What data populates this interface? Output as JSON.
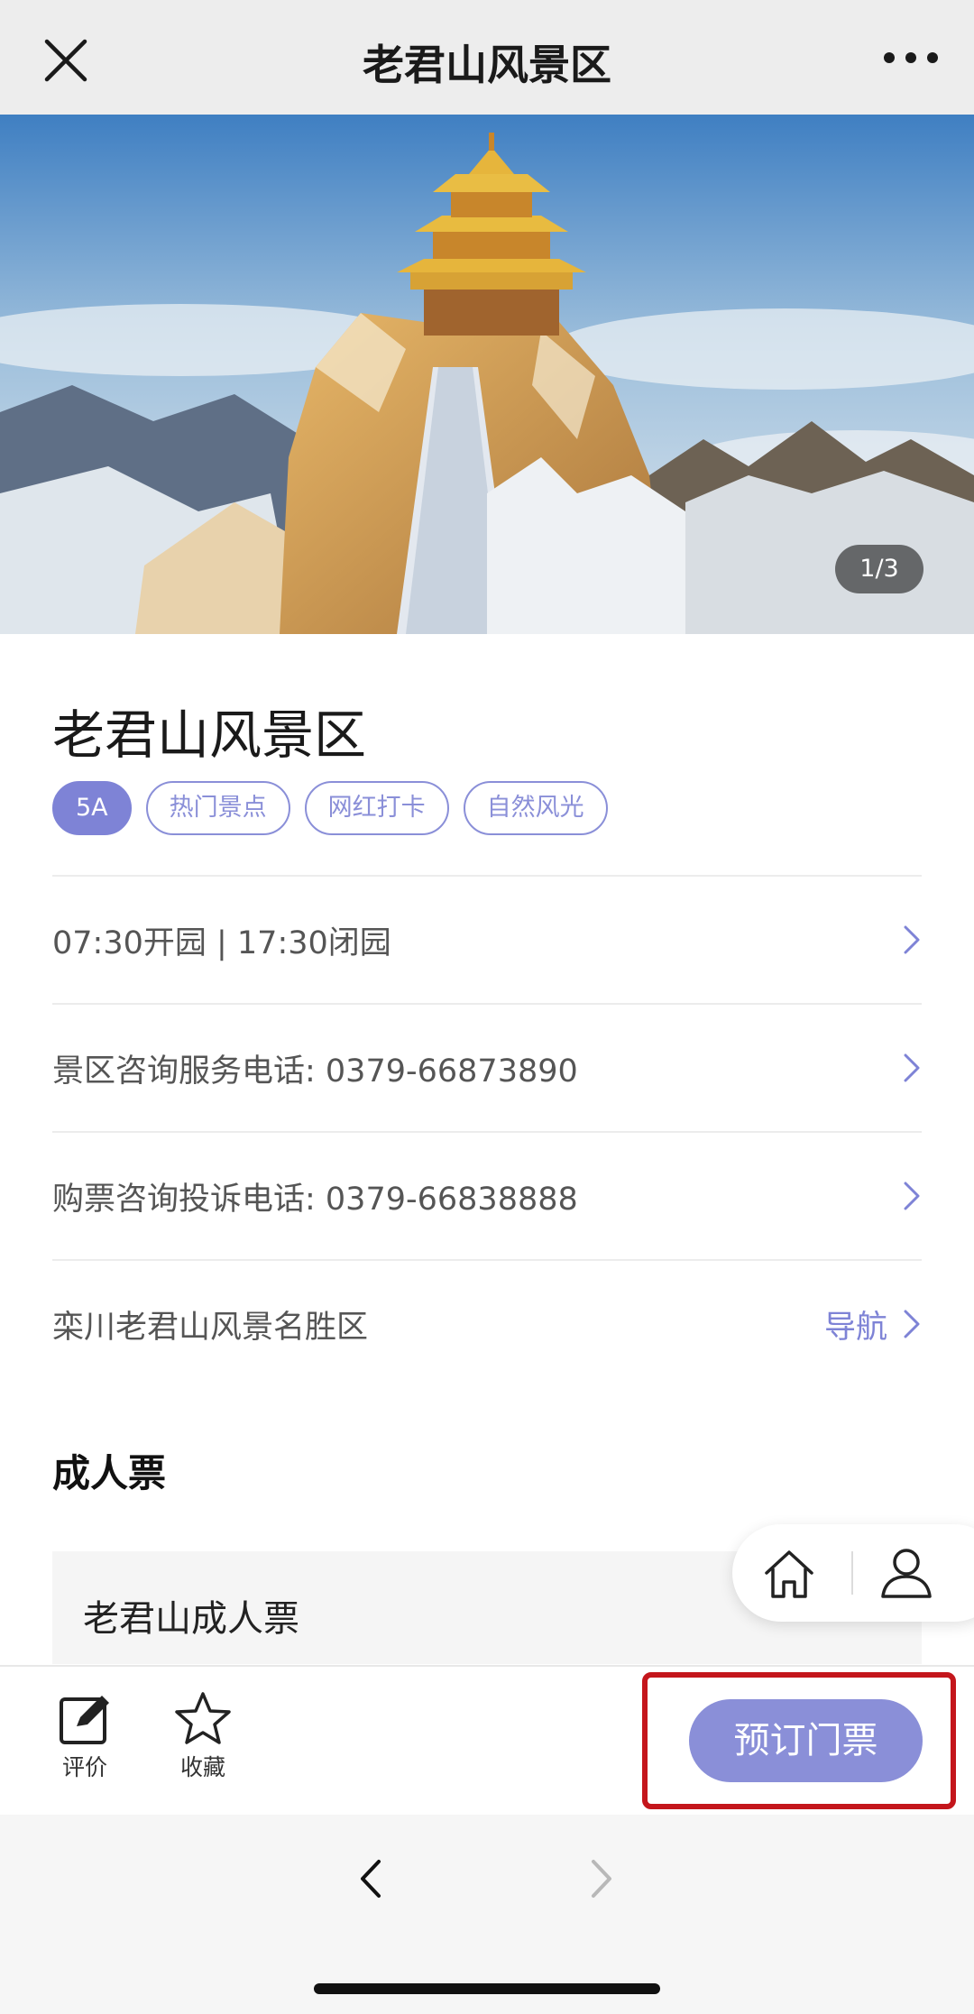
{
  "header": {
    "title": "老君山风景区",
    "close_icon": "close-icon",
    "more_icon": "more-dots-icon"
  },
  "hero": {
    "page_indicator": "1/3"
  },
  "scenic": {
    "title": "老君山风景区",
    "tags": [
      "5A",
      "热门景点",
      "网红打卡",
      "自然风光"
    ]
  },
  "info": {
    "hours": "07:30开园 | 17:30闭园",
    "service_phone": "景区咨询服务电话: 0379-66873890",
    "ticket_phone": "购票咨询投诉电话: 0379-66838888",
    "address": "栾川老君山风景名胜区",
    "nav_label": "导航"
  },
  "tickets": {
    "section_title": "成人票",
    "items": [
      {
        "name": "老君山成人票"
      }
    ]
  },
  "actions": {
    "review_label": "评价",
    "favorite_label": "收藏",
    "book_label": "预订门票"
  },
  "colors": {
    "accent": "#7e83d6",
    "highlight": "#c4161c"
  }
}
